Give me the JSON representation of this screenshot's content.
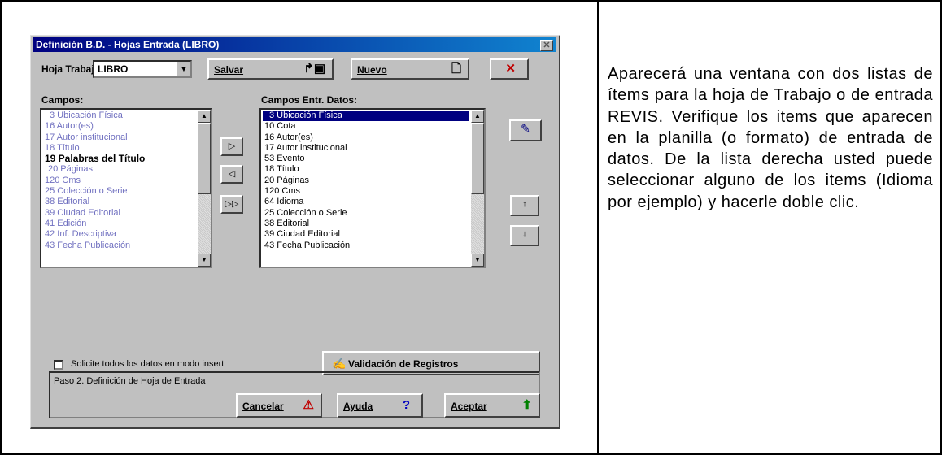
{
  "dialog": {
    "title": "Definición B.D. - Hojas Entrada (LIBRO)",
    "close_icon": "close-icon",
    "hoja_label": "Hoja Trabajo:",
    "hoja_value": "LIBRO",
    "salvar_label": "Salvar",
    "nuevo_label": "Nuevo",
    "campos_label": "Campos:",
    "campos_entr_label": "Campos Entr.  Datos:",
    "campos_list": [
      "3 Ubicación Física",
      "16 Autor(es)",
      "17 Autor institucional",
      "18 Título",
      "19 Palabras del Título",
      "20 Páginas",
      "120 Cms",
      "25 Colección o Serie",
      "38 Editorial",
      "39 Ciudad Editorial",
      "41 Edición",
      "42 Inf. Descriptiva",
      "43 Fecha Publicación"
    ],
    "campos_entr_list": [
      "3 Ubicación Física",
      "10 Cota",
      "16 Autor(es)",
      "17 Autor institucional",
      "53 Evento",
      "18 Título",
      "20 Páginas",
      "120 Cms",
      "64 Idioma",
      "25 Colección o Serie",
      "38 Editorial",
      "39 Ciudad Editorial",
      "43 Fecha Publicación"
    ],
    "checkbox_label": "Solicite todos los datos en modo insert",
    "validacion_label": "Validación de Registros",
    "status_text": "Paso 2. Definición de Hoja de Entrada",
    "cancelar_label": "Cancelar",
    "ayuda_label": "Ayuda",
    "aceptar_label": "Aceptar"
  },
  "side_text": "Aparecerá una ventana con dos listas de ítems para la hoja de Trabajo o de entrada REVIS. Verifique los items que aparecen en la planilla (o formato) de entrada de datos. De la lista derecha usted puede seleccionar alguno de los items (Idioma por ejemplo) y hacerle doble clic."
}
